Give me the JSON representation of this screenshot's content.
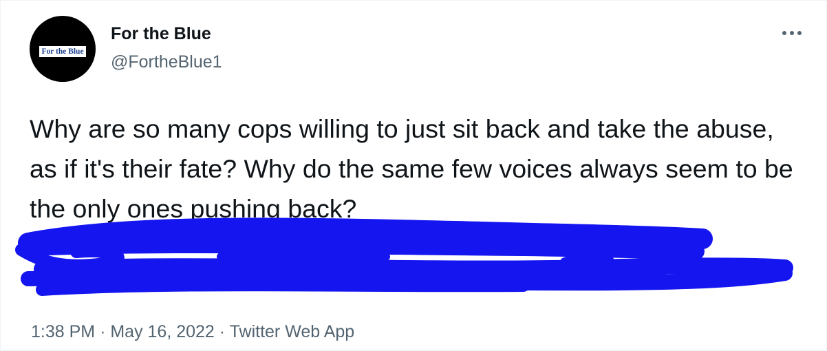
{
  "tweet": {
    "author": {
      "display_name": "For the Blue",
      "handle": "@FortheBlue1",
      "avatar_text": "For the Blue"
    },
    "text": "Why are so many cops willing to just sit back and take the abuse, as if it's their fate? Why do the same few voices always seem to be the only ones pushing back?",
    "meta": {
      "time": "1:38 PM",
      "separator": "·",
      "date": "May 16, 2022",
      "source": "Twitter Web App"
    }
  },
  "icons": {
    "more": "more-horizontal-icon"
  },
  "colors": {
    "text_primary": "#0f1419",
    "text_secondary": "#536471",
    "link": "#1d9bf0",
    "redaction": "#1515f0",
    "avatar_bg": "#000000"
  }
}
